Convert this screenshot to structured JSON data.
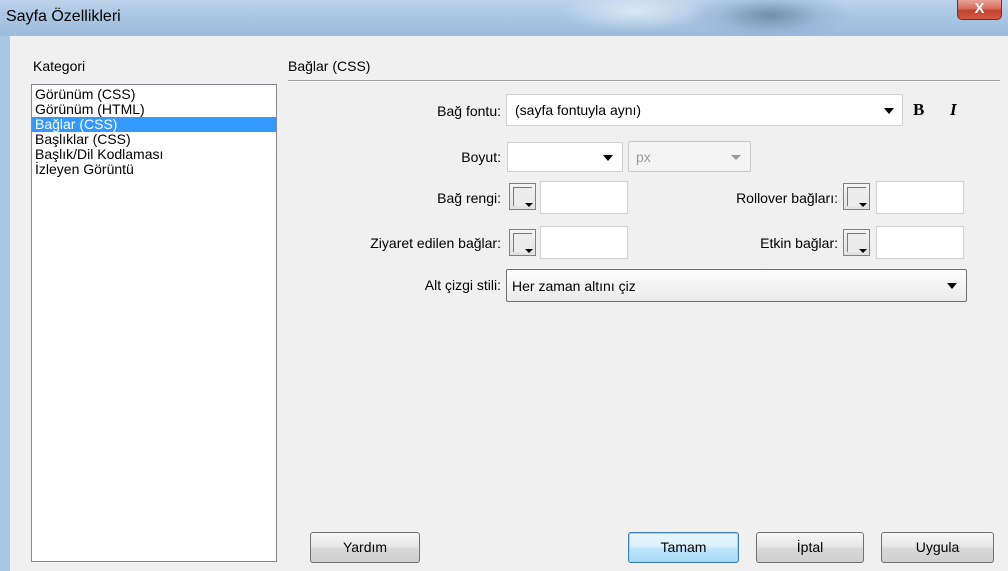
{
  "window": {
    "title": "Sayfa Özellikleri",
    "close_glyph": "X"
  },
  "category": {
    "header": "Kategori",
    "items": [
      {
        "label": "Görünüm (CSS)",
        "selected": false
      },
      {
        "label": "Görünüm (HTML)",
        "selected": false
      },
      {
        "label": "Bağlar (CSS)",
        "selected": true
      },
      {
        "label": "Başlıklar (CSS)",
        "selected": false
      },
      {
        "label": "Başlık/Dil Kodlaması",
        "selected": false
      },
      {
        "label": "İzleyen Görüntü",
        "selected": false
      }
    ]
  },
  "panel": {
    "title": "Bağlar (CSS)",
    "link_font": {
      "label": "Bağ fontu:",
      "value": "(sayfa fontuyla aynı)",
      "bold": "B",
      "italic": "I"
    },
    "size": {
      "label": "Boyut:",
      "value": "",
      "unit": "px"
    },
    "link_color": {
      "label": "Bağ rengi:",
      "value": ""
    },
    "rollover_links": {
      "label": "Rollover bağları:",
      "value": ""
    },
    "visited_links": {
      "label": "Ziyaret edilen bağlar:",
      "value": ""
    },
    "active_links": {
      "label": "Etkin bağlar:",
      "value": ""
    },
    "underline_style": {
      "label": "Alt çizgi stili:",
      "value": "Her zaman altını çiz"
    }
  },
  "buttons": {
    "help": "Yardım",
    "ok": "Tamam",
    "cancel": "İptal",
    "apply": "Uygula"
  },
  "colors": {
    "selection": "#3399ff",
    "titlebar": "#a9c6e4",
    "close": "#c2402d"
  }
}
